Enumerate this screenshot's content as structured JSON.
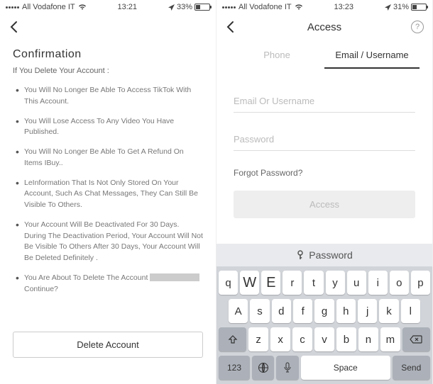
{
  "left": {
    "status": {
      "carrier": "All Vodafone IT",
      "time": "13:21",
      "battery_pct": "33%",
      "battery_fill": 33
    },
    "title": "Confirmation",
    "subtitle": "If You Delete Your Account :",
    "bullets": [
      "You Will No Longer Be Able To Access TikTok With This Account.",
      "You Will Lose Access To Any Video You Have Published.",
      "You Will No Longer Be Able To Get A Refund On Items IBuy..",
      "LeInformation That Is Not Only Stored On Your Account, Such As Chat Messages, They Can Still Be Visible To Others.",
      "Your Account Will Be Deactivated For 30 Days. During The Deactivation Period, Your Account Will Not Be Visible To Others After 30 Days, Your Account Will Be Deleted Definitely .",
      "You Are About To Delete The Account [REDACTED] Continue?"
    ],
    "delete_label": "Delete Account"
  },
  "right": {
    "status": {
      "carrier": "All Vodafone IT",
      "time": "13:23",
      "battery_pct": "31%",
      "battery_fill": 31
    },
    "header_title": "Access",
    "tabs": {
      "phone": "Phone",
      "email": "Email / Username"
    },
    "form": {
      "email_placeholder": "Email Or Username",
      "password_placeholder": "Password",
      "forgot": "Forgot Password?",
      "access_label": "Access"
    },
    "keyboard": {
      "header": "Password",
      "row1": [
        "q",
        "W",
        "E",
        "r",
        "t",
        "y",
        "u",
        "i",
        "o",
        "p"
      ],
      "row2": [
        "A",
        "s",
        "d",
        "f",
        "g",
        "h",
        "j",
        "k",
        "l"
      ],
      "row3": [
        "z",
        "x",
        "c",
        "v",
        "b",
        "n",
        "m"
      ],
      "num_label": "123",
      "space_label": "Space",
      "send_label": "Send"
    }
  }
}
